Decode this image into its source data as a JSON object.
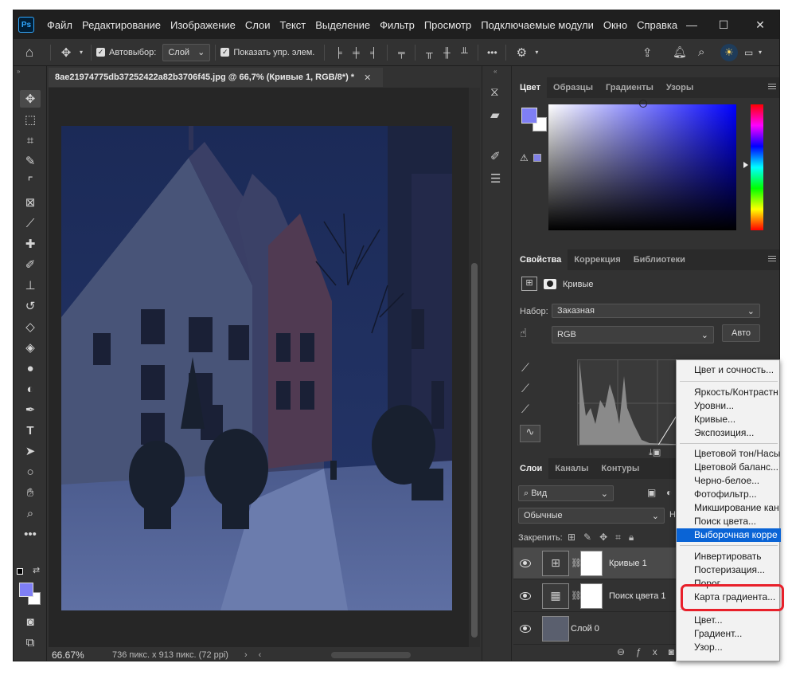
{
  "app": {
    "logo": "Ps"
  },
  "menu": [
    "Файл",
    "Редактирование",
    "Изображение",
    "Слои",
    "Текст",
    "Выделение",
    "Фильтр",
    "Просмотр",
    "Подключаемые модули",
    "Окно",
    "Справка"
  ],
  "options": {
    "autoselect_label": "Автовыбор:",
    "autoselect_value": "Слой",
    "show_controls_label": "Показать упр. элем."
  },
  "document": {
    "tab_title": "8ae21974775db37252422a82b3706f45.jpg @ 66,7% (Кривые 1, RGB/8*) *",
    "zoom": "66.67%",
    "info": "736 пикс. x 913 пикс. (72 ppi)"
  },
  "color_panel": {
    "tabs": [
      "Цвет",
      "Образцы",
      "Градиенты",
      "Узоры"
    ],
    "foreground": "#7f7ff5",
    "background": "#ffffff"
  },
  "properties_panel": {
    "tabs": [
      "Свойства",
      "Коррекция",
      "Библиотеки"
    ],
    "adjustment_name": "Кривые",
    "preset_label": "Набор:",
    "preset_value": "Заказная",
    "channel_value": "RGB",
    "auto_label": "Авто",
    "partial": {
      "layers_dd": "Не"
    }
  },
  "layers_panel": {
    "tabs": [
      "Слои",
      "Каналы",
      "Контуры"
    ],
    "filter_label": "Вид",
    "blend_mode": "Обычные",
    "lock_label": "Закрепить:",
    "layers": [
      {
        "name": "Кривые 1",
        "type": "curves"
      },
      {
        "name": "Поиск цвета 1",
        "type": "lookup"
      },
      {
        "name": "Слой 0",
        "type": "image"
      }
    ]
  },
  "popup_menu": {
    "groups": [
      [
        "Цвет и сочность..."
      ],
      [
        "Яркость/Контрастн",
        "Уровни...",
        "Кривые...",
        "Экспозиция..."
      ],
      [
        "Цветовой тон/Насы",
        "Цветовой баланс...",
        "Черно-белое...",
        "Фотофильтр...",
        "Микширование кан",
        "Поиск цвета...",
        "Выборочная корре"
      ],
      [
        "Инвертировать",
        "Постеризация...",
        "Порог...",
        "Карта градиента..."
      ],
      [
        "Цвет...",
        "Градиент...",
        "Узор..."
      ]
    ],
    "highlighted": "Выборочная корре",
    "annotated": "Карта градиента..."
  }
}
